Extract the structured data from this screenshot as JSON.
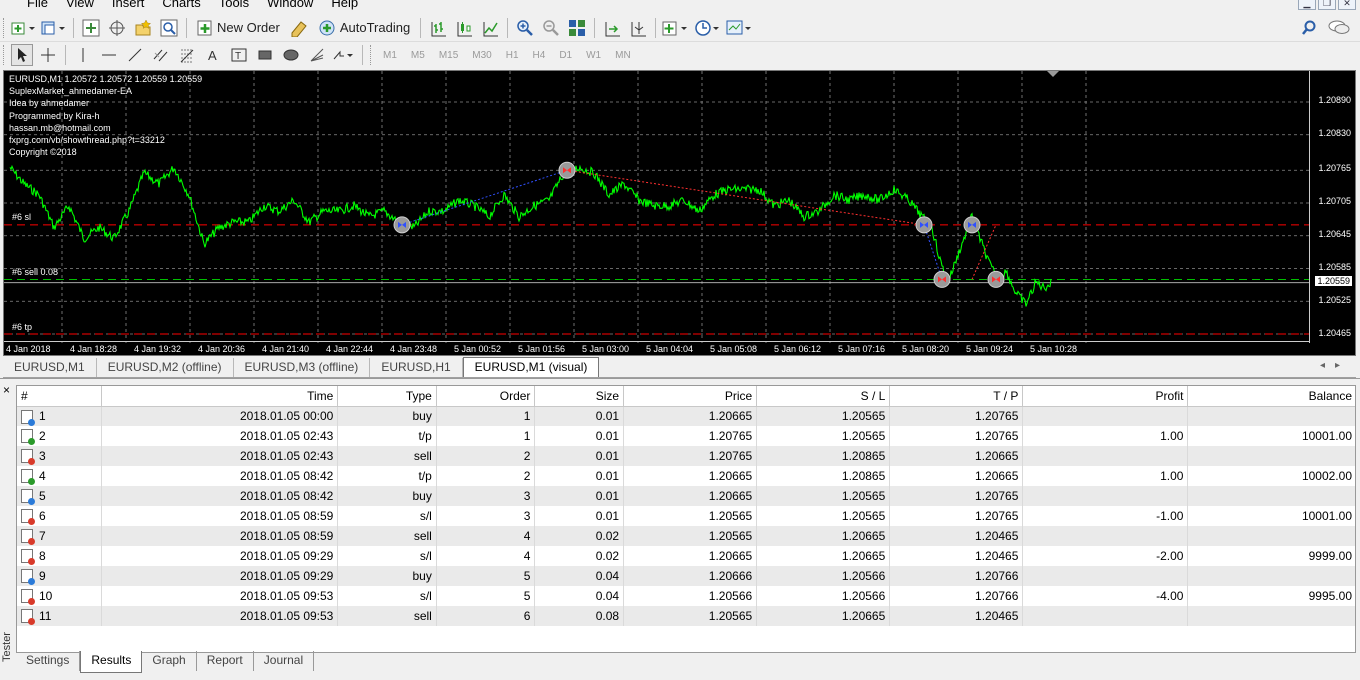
{
  "menu": [
    "File",
    "View",
    "Insert",
    "Charts",
    "Tools",
    "Window",
    "Help"
  ],
  "toolbar": {
    "new_order": "New Order",
    "autotrading": "AutoTrading"
  },
  "timeframes": [
    "M1",
    "M5",
    "M15",
    "M30",
    "H1",
    "H4",
    "D1",
    "W1",
    "MN"
  ],
  "chart": {
    "info_lines": [
      "EURUSD,M1  1.20572 1.20572 1.20559 1.20559",
      "SuplexMarket_ahmedamer-EA",
      "Idea by ahmedamer",
      "Programmed by Kira-h",
      "hassan.mb@hotmail.com",
      "fxprg.com/vb/showthread.php?t=33212",
      "Copyright ©2018"
    ],
    "levels": {
      "sl": "#6 sl",
      "sell": "#6 sell 0.08",
      "tp": "#6 tp"
    },
    "prices": [
      "1.20890",
      "1.20830",
      "1.20765",
      "1.20705",
      "1.20645",
      "1.20585",
      "1.20559",
      "1.20525",
      "1.20465"
    ],
    "current_price": "1.20559",
    "times": [
      "4 Jan 2018",
      "4 Jan 18:28",
      "4 Jan 19:32",
      "4 Jan 20:36",
      "4 Jan 21:40",
      "4 Jan 22:44",
      "4 Jan 23:48",
      "5 Jan 00:52",
      "5 Jan 01:56",
      "5 Jan 03:00",
      "5 Jan 04:04",
      "5 Jan 05:08",
      "5 Jan 06:12",
      "5 Jan 07:16",
      "5 Jan 08:20",
      "5 Jan 09:24",
      "5 Jan 10:28"
    ],
    "colors": {
      "background": "#000000",
      "price_line": "#00ff00",
      "sl_line": "#ff0000",
      "tp_line": "#ff0000",
      "sell_line": "#00ff00"
    }
  },
  "chart_tabs": [
    "EURUSD,M1",
    "EURUSD,M2 (offline)",
    "EURUSD,M3 (offline)",
    "EURUSD,H1",
    "EURUSD,M1 (visual)"
  ],
  "results": {
    "columns": [
      "#",
      "Time",
      "Type",
      "Order",
      "Size",
      "Price",
      "S / L",
      "T / P",
      "Profit",
      "Balance"
    ],
    "rows": [
      {
        "n": "1",
        "time": "2018.01.05 00:00",
        "type": "buy",
        "order": "1",
        "size": "0.01",
        "price": "1.20665",
        "sl": "1.20565",
        "tp": "1.20765",
        "profit": "",
        "balance": "",
        "icon": "buy"
      },
      {
        "n": "2",
        "time": "2018.01.05 02:43",
        "type": "t/p",
        "order": "1",
        "size": "0.01",
        "price": "1.20765",
        "sl": "1.20565",
        "tp": "1.20765",
        "profit": "1.00",
        "balance": "10001.00",
        "icon": "tp"
      },
      {
        "n": "3",
        "time": "2018.01.05 02:43",
        "type": "sell",
        "order": "2",
        "size": "0.01",
        "price": "1.20765",
        "sl": "1.20865",
        "tp": "1.20665",
        "profit": "",
        "balance": "",
        "icon": "sell"
      },
      {
        "n": "4",
        "time": "2018.01.05 08:42",
        "type": "t/p",
        "order": "2",
        "size": "0.01",
        "price": "1.20665",
        "sl": "1.20865",
        "tp": "1.20665",
        "profit": "1.00",
        "balance": "10002.00",
        "icon": "tp"
      },
      {
        "n": "5",
        "time": "2018.01.05 08:42",
        "type": "buy",
        "order": "3",
        "size": "0.01",
        "price": "1.20665",
        "sl": "1.20565",
        "tp": "1.20765",
        "profit": "",
        "balance": "",
        "icon": "buy"
      },
      {
        "n": "6",
        "time": "2018.01.05 08:59",
        "type": "s/l",
        "order": "3",
        "size": "0.01",
        "price": "1.20565",
        "sl": "1.20565",
        "tp": "1.20765",
        "profit": "-1.00",
        "balance": "10001.00",
        "icon": "sl"
      },
      {
        "n": "7",
        "time": "2018.01.05 08:59",
        "type": "sell",
        "order": "4",
        "size": "0.02",
        "price": "1.20565",
        "sl": "1.20665",
        "tp": "1.20465",
        "profit": "",
        "balance": "",
        "icon": "sell"
      },
      {
        "n": "8",
        "time": "2018.01.05 09:29",
        "type": "s/l",
        "order": "4",
        "size": "0.02",
        "price": "1.20665",
        "sl": "1.20665",
        "tp": "1.20465",
        "profit": "-2.00",
        "balance": "9999.00",
        "icon": "sl"
      },
      {
        "n": "9",
        "time": "2018.01.05 09:29",
        "type": "buy",
        "order": "5",
        "size": "0.04",
        "price": "1.20666",
        "sl": "1.20566",
        "tp": "1.20766",
        "profit": "",
        "balance": "",
        "icon": "buy"
      },
      {
        "n": "10",
        "time": "2018.01.05 09:53",
        "type": "s/l",
        "order": "5",
        "size": "0.04",
        "price": "1.20566",
        "sl": "1.20566",
        "tp": "1.20766",
        "profit": "-4.00",
        "balance": "9995.00",
        "icon": "sl"
      },
      {
        "n": "11",
        "time": "2018.01.05 09:53",
        "type": "sell",
        "order": "6",
        "size": "0.08",
        "price": "1.20565",
        "sl": "1.20665",
        "tp": "1.20465",
        "profit": "",
        "balance": "",
        "icon": "sell"
      }
    ]
  },
  "bottom_tabs": [
    "Settings",
    "Results",
    "Graph",
    "Report",
    "Journal"
  ],
  "tester_label": "Tester",
  "close_glyph": "×"
}
